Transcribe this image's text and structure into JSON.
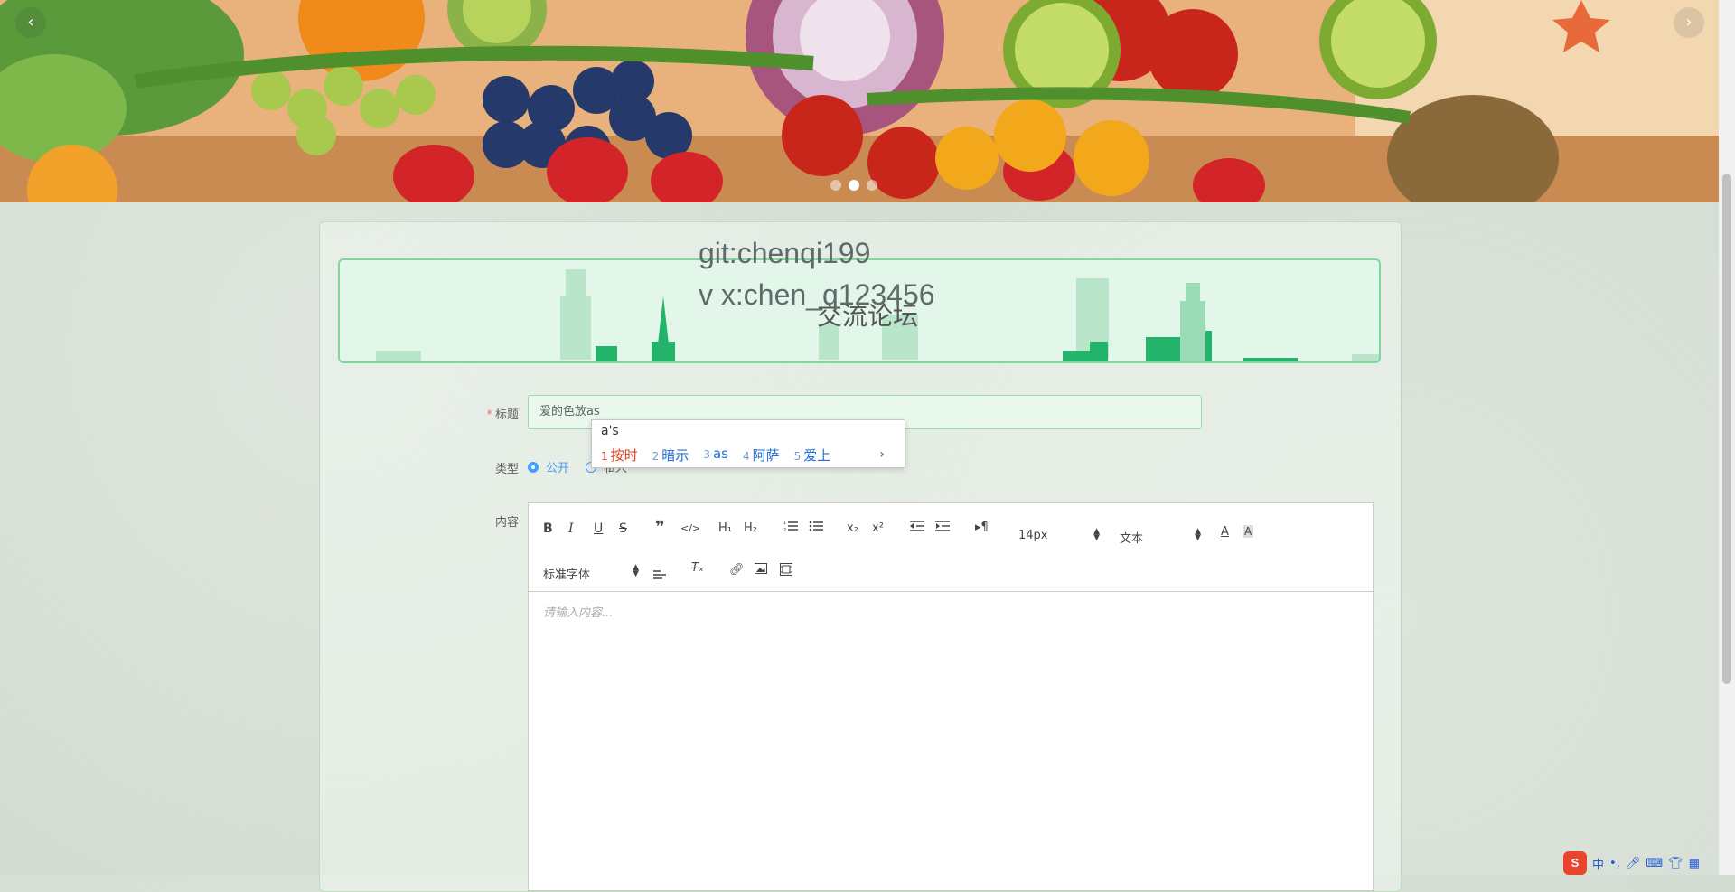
{
  "banner": {
    "prev_arrow": "‹",
    "next_arrow": "›",
    "slide_count": 3,
    "active_slide": 2
  },
  "watermark": {
    "line1": "git:chenqi199",
    "line2": "v x:chen_q123456"
  },
  "header": {
    "title": "交流论坛"
  },
  "form": {
    "title_label": "标题",
    "title_required_mark": "*",
    "title_value": "爱的色放as",
    "type_label": "类型",
    "type_options": [
      "公开",
      "私人"
    ],
    "type_selected": "公开",
    "content_label": "内容"
  },
  "ime": {
    "composition": "a's",
    "candidates": [
      {
        "num": "1",
        "text": "按时"
      },
      {
        "num": "2",
        "text": "暗示"
      },
      {
        "num": "3",
        "text": "as"
      },
      {
        "num": "4",
        "text": "阿萨"
      },
      {
        "num": "5",
        "text": "爱上"
      }
    ],
    "more": "›"
  },
  "editor": {
    "size_value": "14px",
    "header_value": "文本",
    "font_value": "标准字体",
    "placeholder": "请输入内容...",
    "colors": {
      "accent": "#409eff",
      "border": "#cccccc"
    }
  },
  "tray": {
    "ime_logo": "S",
    "lang": "中"
  }
}
